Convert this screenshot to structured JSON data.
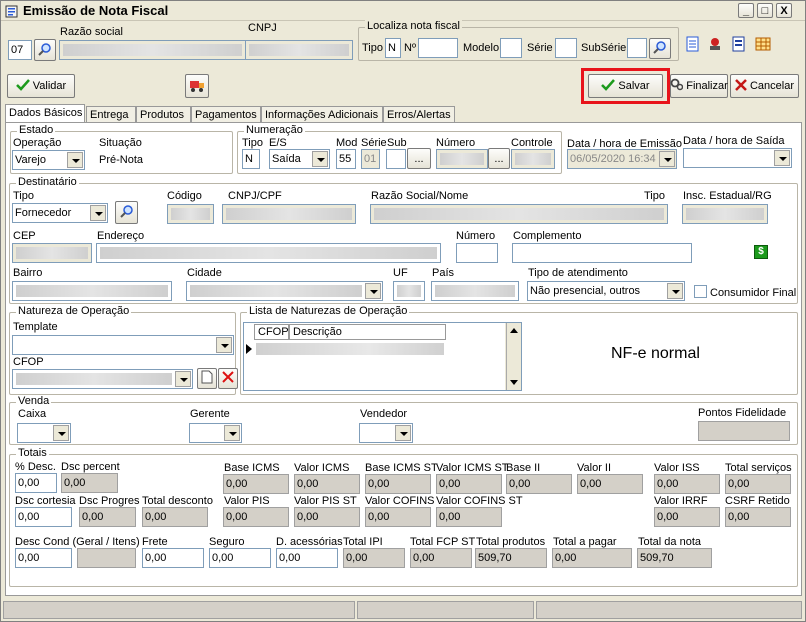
{
  "window": {
    "title": "Emissão de Nota Fiscal",
    "controls": [
      "_",
      "□",
      "X"
    ]
  },
  "header": {
    "code_value": "07",
    "razao_label": "Razão social",
    "cnpj_label": "CNPJ",
    "localiza": {
      "label": "Localiza nota fiscal",
      "tipo_label": "Tipo",
      "tipo_value": "N",
      "numero_label": "Nº",
      "modelo_label": "Modelo",
      "serie_label": "Série",
      "subserie_label": "SubSérie"
    }
  },
  "toolbar": {
    "validar": "Validar",
    "salvar": "Salvar",
    "finalizar": "Finalizar",
    "cancelar": "Cancelar"
  },
  "tabs": [
    "Dados Básicos",
    "Entrega",
    "Produtos",
    "Pagamentos",
    "Informações Adicionais",
    "Erros/Alertas"
  ],
  "estado": {
    "title": "Estado",
    "operacao_label": "Operação",
    "operacao_value": "Varejo",
    "situacao_label": "Situação",
    "situacao_value": "Pré-Nota"
  },
  "numeracao": {
    "title": "Numeração",
    "tipo_label": "Tipo",
    "tipo_value": "N",
    "es_label": "E/S",
    "es_value": "Saída",
    "mod_label": "Mod",
    "mod_value": "55",
    "serie_label": "Série",
    "serie_value": "01",
    "sub_label": "Sub",
    "numero_label": "Número",
    "controle_label": "Controle",
    "browse": "..."
  },
  "emissao": {
    "label": "Data / hora de Emissão",
    "value": "06/05/2020 16:34"
  },
  "saida": {
    "label": "Data / hora de Saída"
  },
  "destinatario": {
    "title": "Destinatário",
    "tipo_label": "Tipo",
    "tipo_value": "Fornecedor",
    "codigo_label": "Código",
    "cnpj_label": "CNPJ/CPF",
    "razao_label": "Razão Social/Nome",
    "tipo2_label": "Tipo",
    "ie_label": "Insc. Estadual/RG",
    "cep_label": "CEP",
    "endereco_label": "Endereço",
    "numero_label": "Número",
    "complemento_label": "Complemento",
    "bairro_label": "Bairro",
    "cidade_label": "Cidade",
    "uf_label": "UF",
    "pais_label": "País",
    "atendimento_label": "Tipo de atendimento",
    "atendimento_value": "Não presencial, outros",
    "consumidor_label": "Consumidor Final"
  },
  "natureza": {
    "title": "Natureza de Operação",
    "template_label": "Template",
    "cfop_label": "CFOP"
  },
  "lista": {
    "title": "Lista de Naturezas de Operação",
    "col_cfop": "CFOP",
    "col_desc": "Descrição"
  },
  "nfe_label": "NF-e normal",
  "venda": {
    "title": "Venda",
    "caixa_label": "Caixa",
    "gerente_label": "Gerente",
    "vendedor_label": "Vendedor",
    "pontos_label": "Pontos Fidelidade"
  },
  "totais": {
    "title": "Totais",
    "desc_pct_label": "% Desc.",
    "desc_pct": "0,00",
    "dsc_percent_label": "Dsc percent",
    "dsc_percent": "0,00",
    "base_icms_label": "Base ICMS",
    "base_icms": "0,00",
    "valor_icms_label": "Valor ICMS",
    "valor_icms": "0,00",
    "base_icms_st_label": "Base ICMS ST",
    "base_icms_st": "0,00",
    "valor_icms_st_label": "Valor ICMS ST",
    "valor_icms_st": "0,00",
    "base_ii_label": "Base II",
    "base_ii": "0,00",
    "valor_ii_label": "Valor II",
    "valor_ii": "0,00",
    "valor_iss_label": "Valor ISS",
    "valor_iss": "0,00",
    "total_servicos_label": "Total serviços",
    "total_servicos": "0,00",
    "dsc_cortesia_label": "Dsc cortesia",
    "dsc_cortesia": "0,00",
    "dsc_progres_label": "Dsc Progres",
    "dsc_progres": "0,00",
    "total_desconto_label": "Total desconto",
    "total_desconto": "0,00",
    "valor_pis_label": "Valor PIS",
    "valor_pis": "0,00",
    "valor_pis_st_label": "Valor PIS ST",
    "valor_pis_st": "0,00",
    "valor_cofins_label": "Valor COFINS",
    "valor_cofins": "0,00",
    "valor_cofins_st_label": "Valor COFINS ST",
    "valor_cofins_st": "0,00",
    "valor_irrf_label": "Valor IRRF",
    "valor_irrf": "0,00",
    "csrf_label": "CSRF Retido",
    "csrf": "0,00",
    "desc_cond_label": "Desc Cond (Geral / Itens)",
    "desc_cond": "0,00",
    "frete_label": "Frete",
    "frete": "0,00",
    "seguro_label": "Seguro",
    "seguro": "0,00",
    "acessorias_label": "D. acessórias",
    "acessorias": "0,00",
    "total_ipi_label": "Total IPI",
    "total_ipi": "0,00",
    "total_fcp_st_label": "Total FCP ST",
    "total_fcp_st": "0,00",
    "total_produtos_label": "Total produtos",
    "total_produtos": "509,70",
    "total_pagar_label": "Total a pagar",
    "total_pagar": "0,00",
    "total_nota_label": "Total da nota",
    "total_nota": "509,70"
  },
  "colors": {
    "highlight": "#e8141b",
    "accent_green": "#1c9a1c",
    "panel": "#ece9d8"
  }
}
